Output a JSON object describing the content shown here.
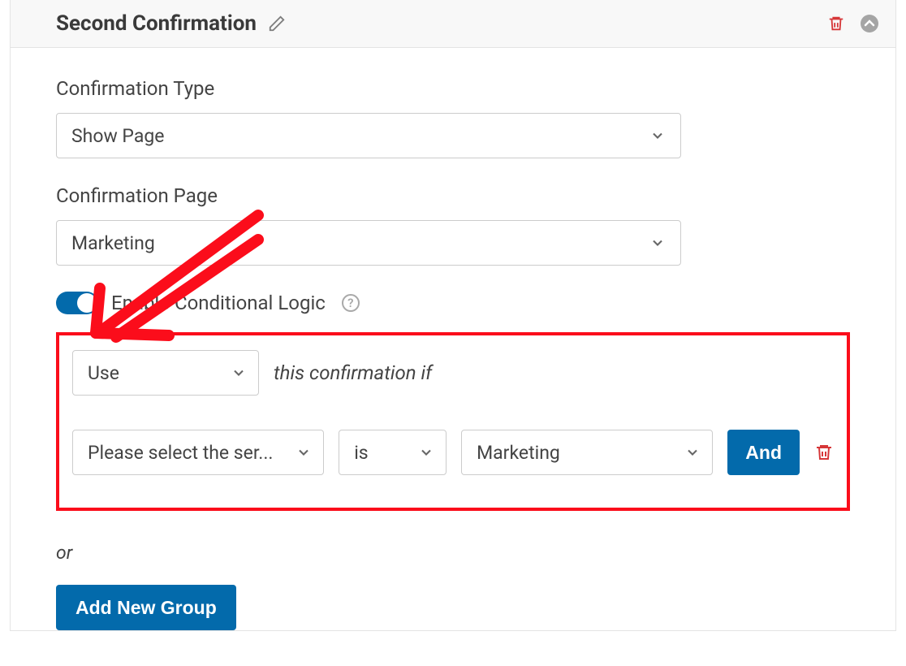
{
  "header": {
    "title": "Second Confirmation"
  },
  "confirmationType": {
    "label": "Confirmation Type",
    "value": "Show Page"
  },
  "confirmationPage": {
    "label": "Confirmation Page",
    "value": "Marketing"
  },
  "conditionalLogic": {
    "toggleLabel": "Enable Conditional Logic",
    "useSelect": "Use",
    "suffixText": "this confirmation if",
    "rule": {
      "field": "Please select the ser...",
      "operator": "is",
      "value": "Marketing",
      "andLabel": "And"
    },
    "orLabel": "or",
    "addGroupLabel": "Add New Group"
  },
  "colors": {
    "accent": "#036aab",
    "annotation": "#fb0d1b",
    "delete": "#d63638"
  }
}
